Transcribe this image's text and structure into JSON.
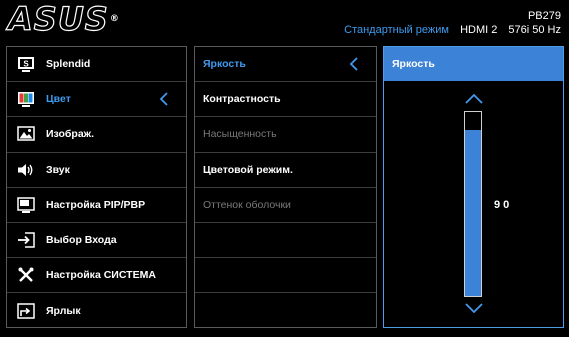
{
  "header": {
    "logo": "ASUS",
    "logo_mark": "®",
    "model": "PB279",
    "mode": "Стандартный режим",
    "input": "HDMI 2",
    "resolution": "576i 50 Hz"
  },
  "main_menu": {
    "items": [
      {
        "label": "Splendid",
        "icon": "splendid-icon"
      },
      {
        "label": "Цвет",
        "icon": "color-icon"
      },
      {
        "label": "Изображ.",
        "icon": "image-icon"
      },
      {
        "label": "Звук",
        "icon": "speaker-icon"
      },
      {
        "label": "Настройка PIP/PBP",
        "icon": "pip-icon"
      },
      {
        "label": "Выбор Входа",
        "icon": "input-select-icon"
      },
      {
        "label": "Настройка СИСТЕМА",
        "icon": "tools-icon"
      },
      {
        "label": "Ярлык",
        "icon": "shortcut-icon"
      }
    ],
    "selected": "Цвет"
  },
  "sub_menu": {
    "items": [
      {
        "label": "Яркость",
        "state": "active"
      },
      {
        "label": "Контрастность",
        "state": "normal"
      },
      {
        "label": "Насыщенность",
        "state": "disabled"
      },
      {
        "label": "Цветовой режим.",
        "state": "normal"
      },
      {
        "label": "Оттенок оболочки",
        "state": "disabled"
      }
    ]
  },
  "value_panel": {
    "title": "Яркость",
    "value": "90",
    "level_percent": 90,
    "accent": "#3c82d6",
    "highlight": "#3f9bef"
  }
}
